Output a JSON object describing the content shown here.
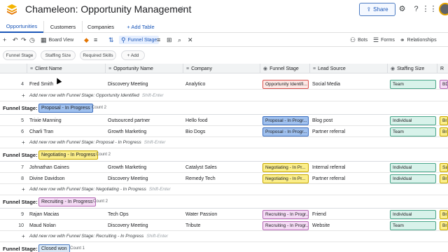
{
  "header": {
    "title": "Chameleon: Opportunity Management",
    "share_label": "Share"
  },
  "tabs": [
    {
      "label": "Opportunities"
    },
    {
      "label": "Customers"
    },
    {
      "label": "Companies"
    },
    {
      "label": "+ Add Table"
    }
  ],
  "toolbar": {
    "view_label": "Board View",
    "funnel_label": "Funnel Stage",
    "bots_label": "Bots",
    "forms_label": "Forms",
    "relationships_label": "Relationships"
  },
  "chips": [
    {
      "label": "Funnel Stage"
    },
    {
      "label": "Staffing Size"
    },
    {
      "label": "Required Skills"
    },
    {
      "label": "+ Add"
    }
  ],
  "columns": [
    {
      "label": "Client Name"
    },
    {
      "label": "Opportunity Name"
    },
    {
      "label": "Company"
    },
    {
      "label": "Funnel Stage"
    },
    {
      "label": "Lead Source"
    },
    {
      "label": "Staffing Size"
    },
    {
      "label": "R"
    }
  ],
  "colors": {
    "identified_bg": "#fde7e4",
    "identified_border": "#d9534f",
    "proposal_bg": "#9fc0ee",
    "proposal_border": "#3d6fbf",
    "negotiating_bg": "#fbee8a",
    "negotiating_border": "#c7a800",
    "recruiting_bg": "#f5dbf5",
    "recruiting_border": "#b56bb5",
    "staffing_bg": "#d8f2ea",
    "staffing_border": "#4aa58a",
    "closed_bg": "#d8e7f5",
    "closed_border": "#4d7cc2"
  },
  "rows_top": [
    {
      "num": "4",
      "client": "Fred Smith",
      "opp": "Discovery Meeting",
      "company": "Analytico",
      "stage": "Opportunity Identifi...",
      "lead": "Social Media",
      "staffing": "Team",
      "extra": "BD"
    }
  ],
  "groups": [
    {
      "label": "Funnel Stage:",
      "stage": "Proposal - In Progress",
      "count": "Count 2",
      "rows": [
        {
          "num": "5",
          "client": "Trixie Manning",
          "opp": "Outsourced partner",
          "company": "Hello food",
          "stage": "Proposal - In Progr...",
          "lead": "Blog post",
          "staffing": "Individual",
          "extra": "Bran"
        },
        {
          "num": "6",
          "client": "Charli Tran",
          "opp": "Growth Marketing",
          "company": "Bio Dogs",
          "stage": "Proposal - In Progr...",
          "lead": "Partner referral",
          "staffing": "Team",
          "extra": "Bran"
        }
      ],
      "add_row": "Add new row with Funnel Stage: Proposal - In Progress"
    },
    {
      "label": "Funnel Stage:",
      "stage": "Negotiating - In Progress",
      "count": "Count 2",
      "rows": [
        {
          "num": "7",
          "client": "Johnathan Gaines",
          "opp": "Growth Marketing",
          "company": "Catalyst Sales",
          "stage": "Negotiating - In Pr...",
          "lead": "Internal referral",
          "staffing": "Individual",
          "extra": "Sale"
        },
        {
          "num": "8",
          "client": "Divine Davidson",
          "opp": "Discovery Meeting",
          "company": "Remedy Tech",
          "stage": "Negotiating - In Pr...",
          "lead": "Partner referral",
          "staffing": "Individual",
          "extra": "Bran"
        }
      ],
      "add_row": "Add new row with Funnel Stage: Negotiating - In Progress"
    },
    {
      "label": "Funnel Stage:",
      "stage": "Recruiting - In Progress",
      "count": "Count 2",
      "rows": [
        {
          "num": "9",
          "client": "Rajan Macias",
          "opp": "Tech Ops",
          "company": "Water Passion",
          "stage": "Recruiting - In Progr...",
          "lead": "Friend",
          "staffing": "Individual",
          "extra": "Bran"
        },
        {
          "num": "10",
          "client": "Maud Nolan",
          "opp": "Discovery Meeting",
          "company": "Tribute",
          "stage": "Recruiting - In Progr...",
          "lead": "Website",
          "staffing": "Team",
          "extra": "Bran"
        }
      ],
      "add_row": "Add new row with Funnel Stage: Recruiting - In Progress"
    },
    {
      "label": "Funnel Stage:",
      "stage": "Closed won",
      "count": "Count 1",
      "rows": [],
      "add_row": ""
    }
  ],
  "add_row_identified": "Add new row with Funnel Stage: Opportunity Identified",
  "shift_hint": "Shift-Enter"
}
